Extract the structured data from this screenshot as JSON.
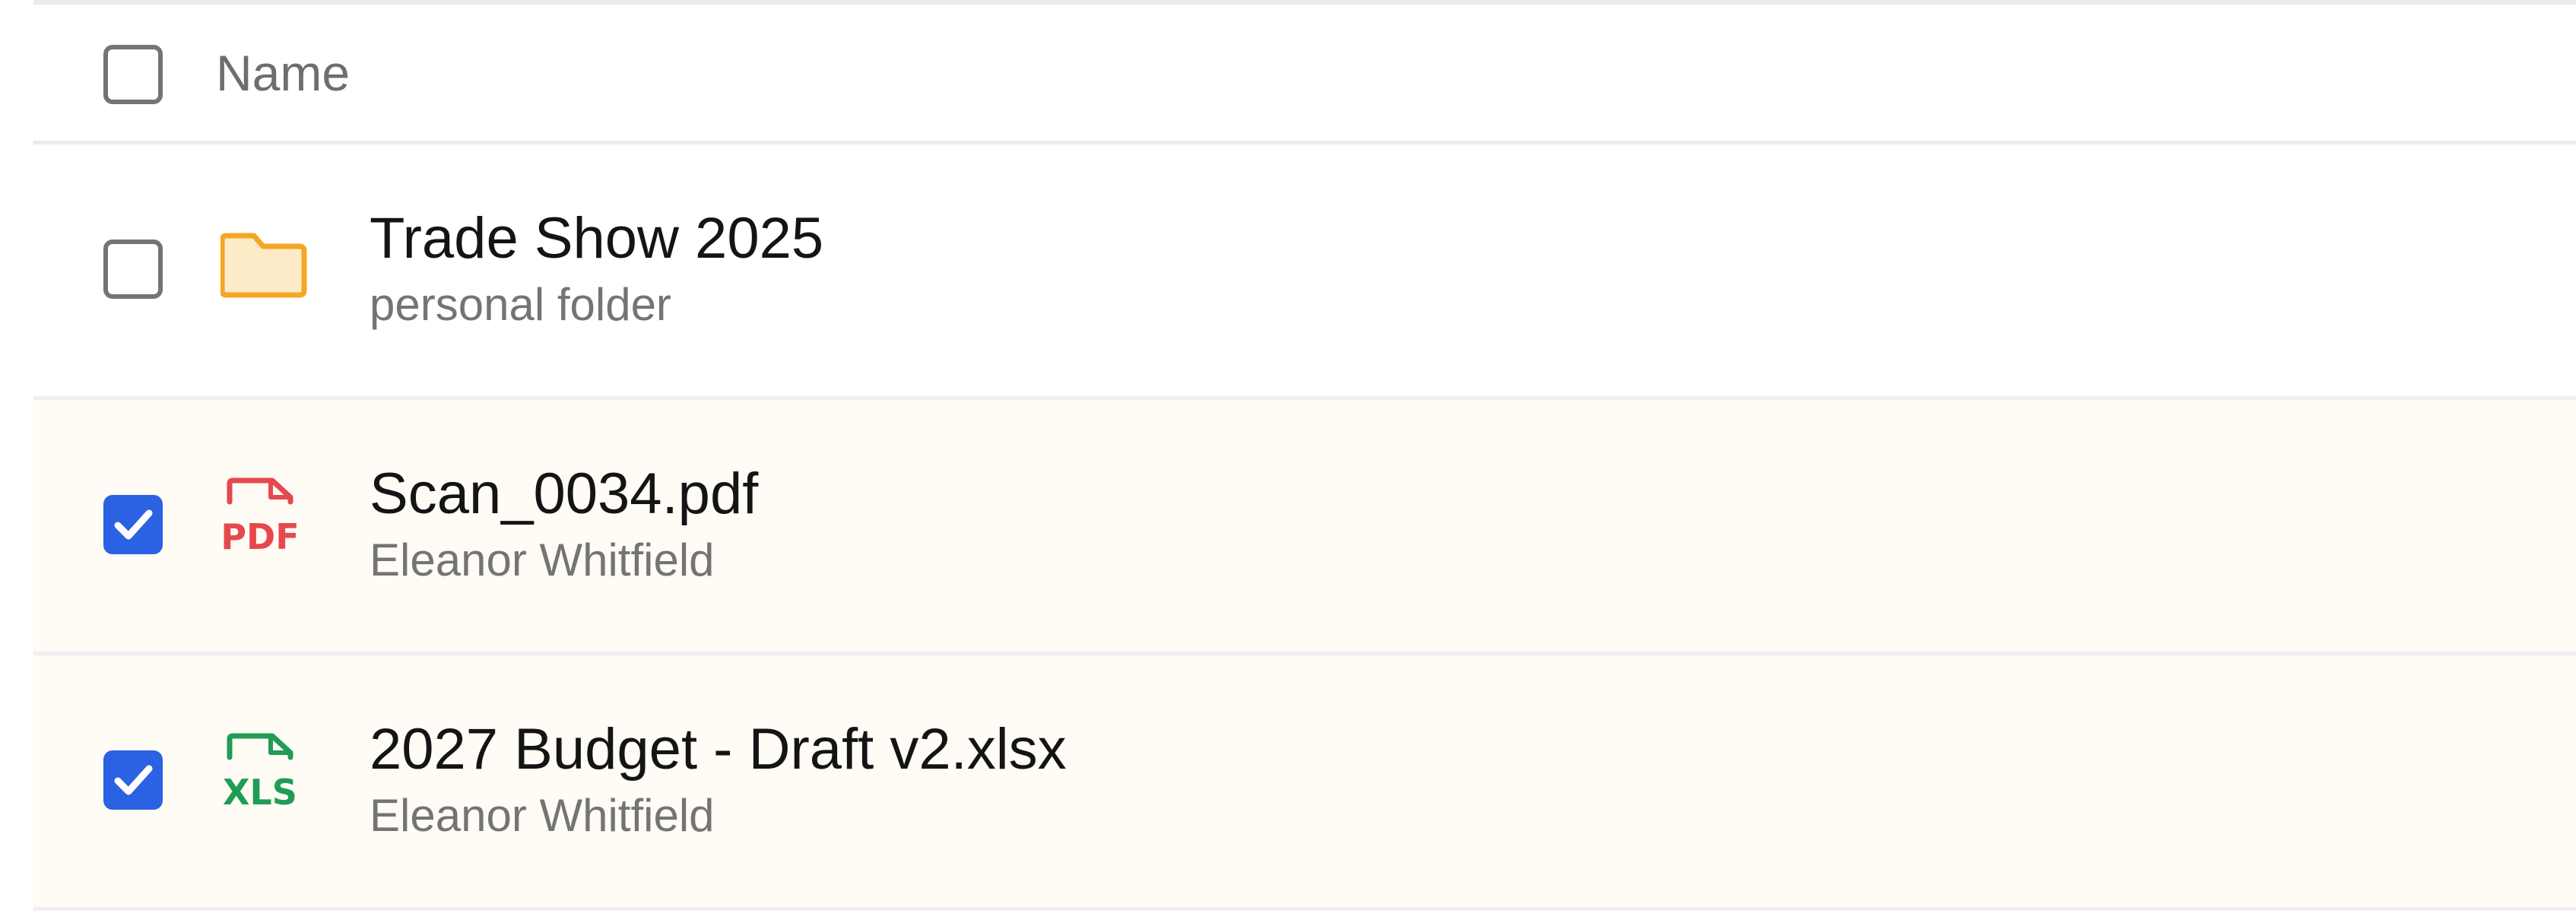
{
  "header": {
    "name_label": "Name"
  },
  "colors": {
    "accent": "#2b62e3",
    "folder": "#f5a623",
    "pdf": "#e5484d",
    "xls": "#1f9d55",
    "selected_row_bg": "#fffbf5"
  },
  "rows": [
    {
      "name": "Trade Show 2025",
      "subtitle": "personal folder",
      "icon": "folder-icon",
      "selected": false
    },
    {
      "name": "Scan_0034.pdf",
      "subtitle": "Eleanor Whitfield",
      "icon": "pdf-file-icon",
      "icon_text": "PDF",
      "selected": true
    },
    {
      "name": "2027 Budget - Draft v2.xlsx",
      "subtitle": "Eleanor Whitfield",
      "icon": "xls-file-icon",
      "icon_text": "XLS",
      "selected": true
    }
  ]
}
